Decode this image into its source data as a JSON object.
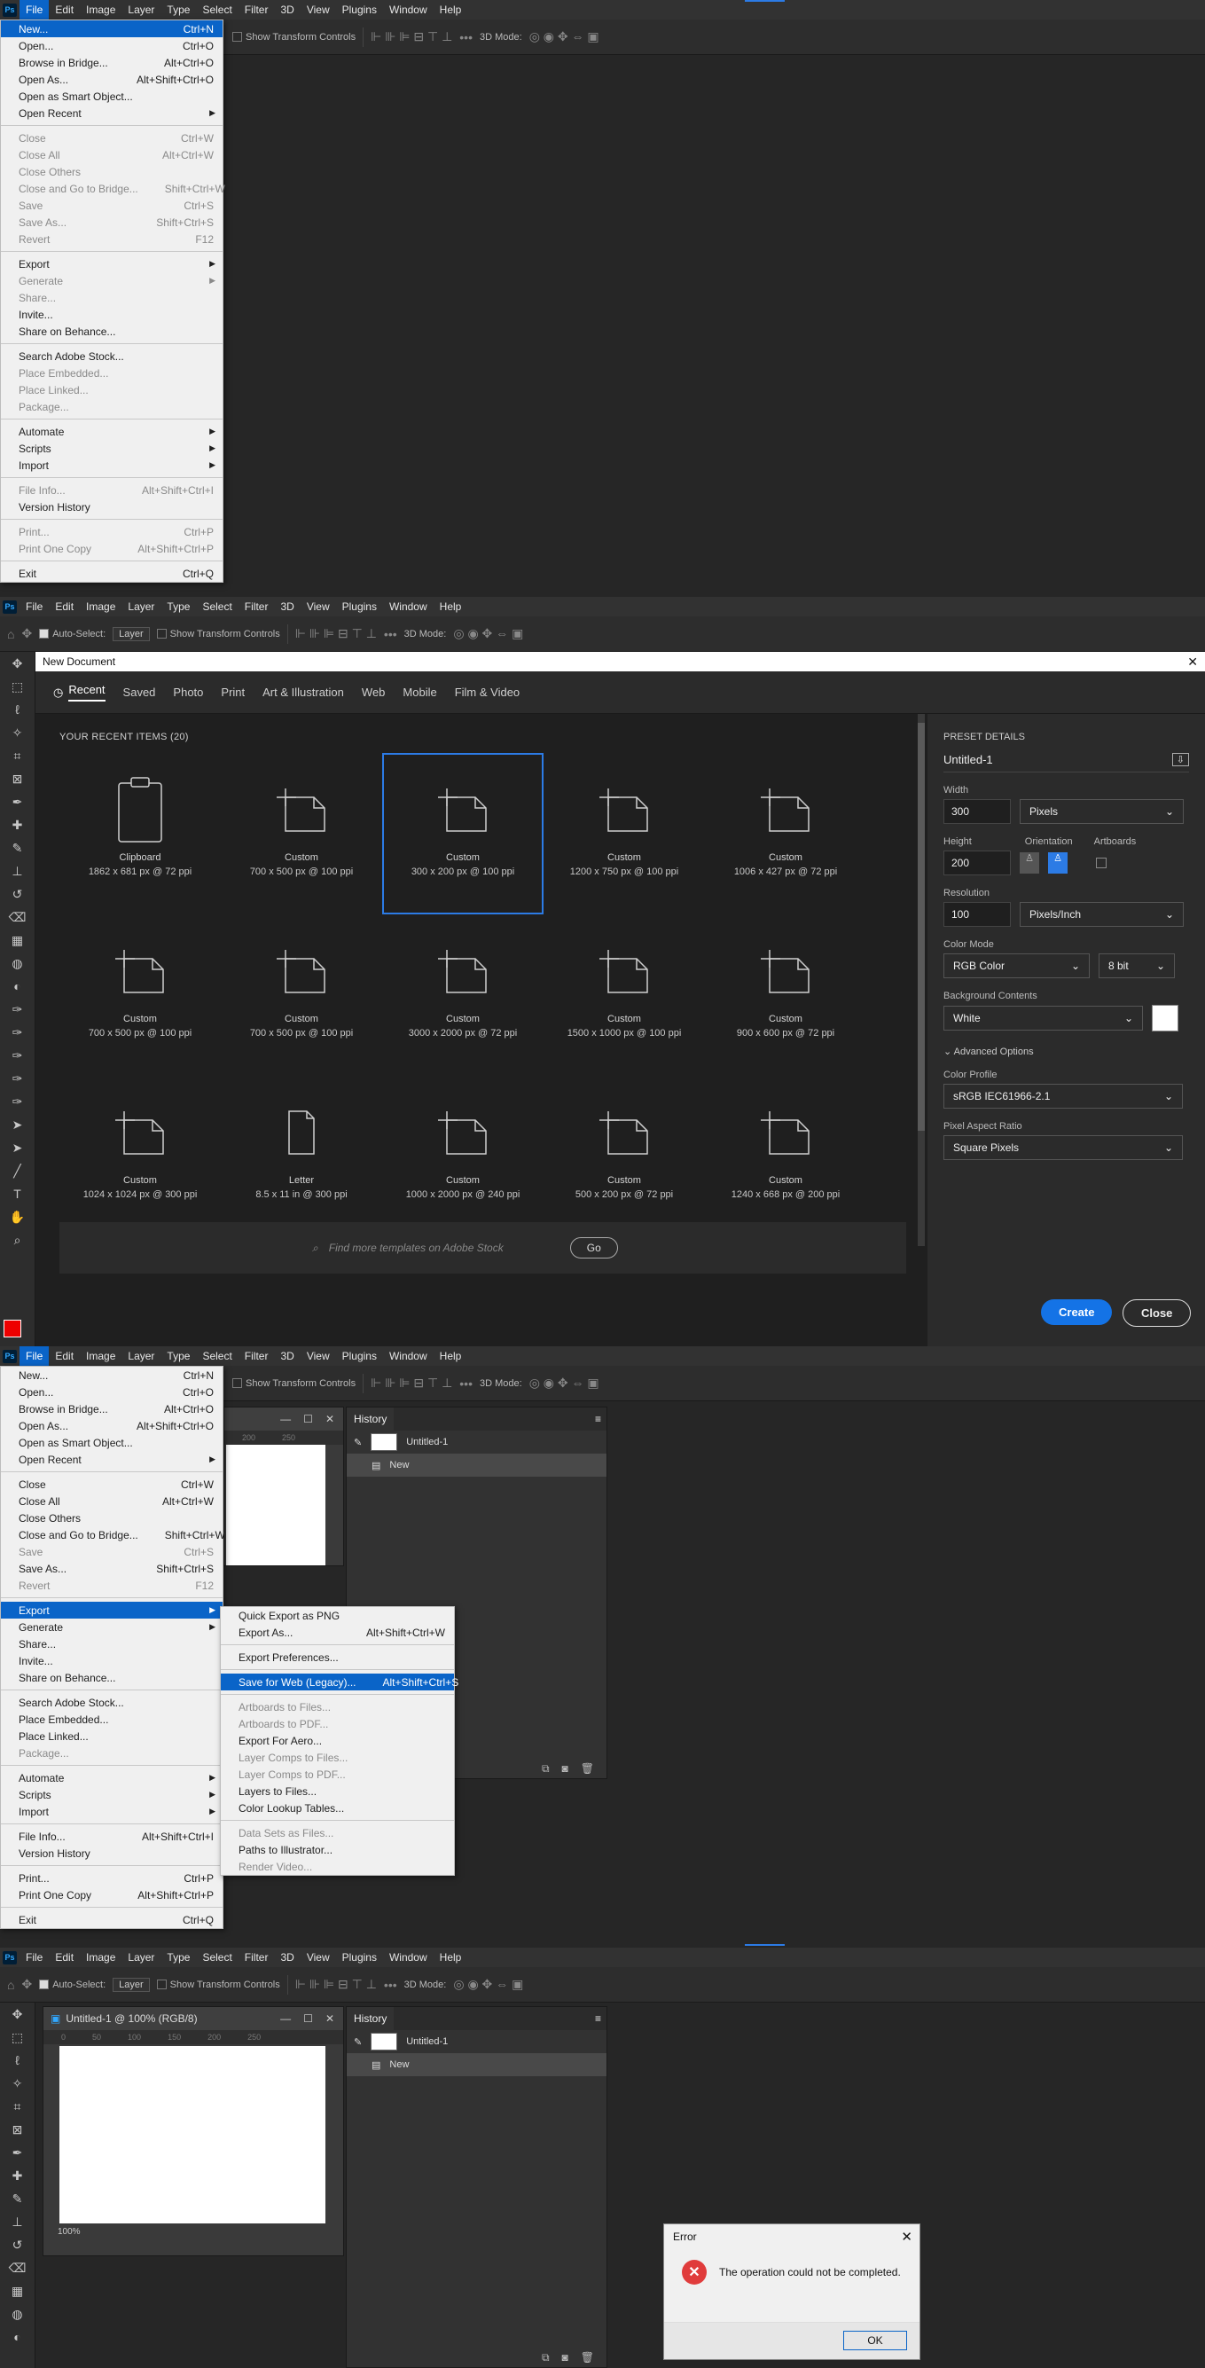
{
  "menubar": [
    "File",
    "Edit",
    "Image",
    "Layer",
    "Type",
    "Select",
    "Filter",
    "3D",
    "View",
    "Plugins",
    "Window",
    "Help"
  ],
  "ps_logo": "Ps",
  "options": {
    "show_transform": "Show Transform Controls",
    "auto_select": "Auto-Select:",
    "layer": "Layer",
    "mode_3d": "3D Mode:"
  },
  "file_menu_1": [
    {
      "l": "New...",
      "s": "Ctrl+N",
      "hl": true
    },
    {
      "l": "Open...",
      "s": "Ctrl+O"
    },
    {
      "l": "Browse in Bridge...",
      "s": "Alt+Ctrl+O"
    },
    {
      "l": "Open As...",
      "s": "Alt+Shift+Ctrl+O"
    },
    {
      "l": "Open as Smart Object..."
    },
    {
      "l": "Open Recent",
      "arrow": true
    },
    {
      "sep": true
    },
    {
      "l": "Close",
      "s": "Ctrl+W",
      "dis": true
    },
    {
      "l": "Close All",
      "s": "Alt+Ctrl+W",
      "dis": true
    },
    {
      "l": "Close Others",
      "dis": true
    },
    {
      "l": "Close and Go to Bridge...",
      "s": "Shift+Ctrl+W",
      "dis": true
    },
    {
      "l": "Save",
      "s": "Ctrl+S",
      "dis": true
    },
    {
      "l": "Save As...",
      "s": "Shift+Ctrl+S",
      "dis": true
    },
    {
      "l": "Revert",
      "s": "F12",
      "dis": true
    },
    {
      "sep": true
    },
    {
      "l": "Export",
      "arrow": true
    },
    {
      "l": "Generate",
      "arrow": true,
      "dis": true
    },
    {
      "l": "Share...",
      "dis": true
    },
    {
      "l": "Invite..."
    },
    {
      "l": "Share on Behance..."
    },
    {
      "sep": true
    },
    {
      "l": "Search Adobe Stock..."
    },
    {
      "l": "Place Embedded...",
      "dis": true
    },
    {
      "l": "Place Linked...",
      "dis": true
    },
    {
      "l": "Package...",
      "dis": true
    },
    {
      "sep": true
    },
    {
      "l": "Automate",
      "arrow": true
    },
    {
      "l": "Scripts",
      "arrow": true
    },
    {
      "l": "Import",
      "arrow": true
    },
    {
      "sep": true
    },
    {
      "l": "File Info...",
      "s": "Alt+Shift+Ctrl+I",
      "dis": true
    },
    {
      "l": "Version History"
    },
    {
      "sep": true
    },
    {
      "l": "Print...",
      "s": "Ctrl+P",
      "dis": true
    },
    {
      "l": "Print One Copy",
      "s": "Alt+Shift+Ctrl+P",
      "dis": true
    },
    {
      "sep": true
    },
    {
      "l": "Exit",
      "s": "Ctrl+Q"
    }
  ],
  "file_menu_3": [
    {
      "l": "New...",
      "s": "Ctrl+N"
    },
    {
      "l": "Open...",
      "s": "Ctrl+O"
    },
    {
      "l": "Browse in Bridge...",
      "s": "Alt+Ctrl+O"
    },
    {
      "l": "Open As...",
      "s": "Alt+Shift+Ctrl+O"
    },
    {
      "l": "Open as Smart Object..."
    },
    {
      "l": "Open Recent",
      "arrow": true
    },
    {
      "sep": true
    },
    {
      "l": "Close",
      "s": "Ctrl+W"
    },
    {
      "l": "Close All",
      "s": "Alt+Ctrl+W"
    },
    {
      "l": "Close Others"
    },
    {
      "l": "Close and Go to Bridge...",
      "s": "Shift+Ctrl+W"
    },
    {
      "l": "Save",
      "s": "Ctrl+S",
      "dis": true
    },
    {
      "l": "Save As...",
      "s": "Shift+Ctrl+S"
    },
    {
      "l": "Revert",
      "s": "F12",
      "dis": true
    },
    {
      "sep": true
    },
    {
      "l": "Export",
      "arrow": true,
      "hl": true
    },
    {
      "l": "Generate",
      "arrow": true
    },
    {
      "l": "Share..."
    },
    {
      "l": "Invite..."
    },
    {
      "l": "Share on Behance..."
    },
    {
      "sep": true
    },
    {
      "l": "Search Adobe Stock..."
    },
    {
      "l": "Place Embedded..."
    },
    {
      "l": "Place Linked..."
    },
    {
      "l": "Package...",
      "dis": true
    },
    {
      "sep": true
    },
    {
      "l": "Automate",
      "arrow": true
    },
    {
      "l": "Scripts",
      "arrow": true
    },
    {
      "l": "Import",
      "arrow": true
    },
    {
      "sep": true
    },
    {
      "l": "File Info...",
      "s": "Alt+Shift+Ctrl+I"
    },
    {
      "l": "Version History"
    },
    {
      "sep": true
    },
    {
      "l": "Print...",
      "s": "Ctrl+P"
    },
    {
      "l": "Print One Copy",
      "s": "Alt+Shift+Ctrl+P"
    },
    {
      "sep": true
    },
    {
      "l": "Exit",
      "s": "Ctrl+Q"
    }
  ],
  "export_menu": [
    {
      "l": "Quick Export as PNG"
    },
    {
      "l": "Export As...",
      "s": "Alt+Shift+Ctrl+W"
    },
    {
      "sep": true
    },
    {
      "l": "Export Preferences..."
    },
    {
      "sep": true
    },
    {
      "l": "Save for Web (Legacy)...",
      "s": "Alt+Shift+Ctrl+S",
      "hl": true
    },
    {
      "sep": true
    },
    {
      "l": "Artboards to Files...",
      "dis": true
    },
    {
      "l": "Artboards to PDF...",
      "dis": true
    },
    {
      "l": "Export For Aero..."
    },
    {
      "l": "Layer Comps to Files...",
      "dis": true
    },
    {
      "l": "Layer Comps to PDF...",
      "dis": true
    },
    {
      "l": "Layers to Files..."
    },
    {
      "l": "Color Lookup Tables..."
    },
    {
      "sep": true
    },
    {
      "l": "Data Sets as Files...",
      "dis": true
    },
    {
      "l": "Paths to Illustrator..."
    },
    {
      "l": "Render Video...",
      "dis": true
    }
  ],
  "new_doc": {
    "title": "New Document",
    "tabs": [
      "Recent",
      "Saved",
      "Photo",
      "Print",
      "Art & Illustration",
      "Web",
      "Mobile",
      "Film & Video"
    ],
    "section": "YOUR RECENT ITEMS  (20)",
    "items": [
      {
        "n": "Clipboard",
        "d": "1862 x 681 px @ 72 ppi",
        "icon": "clipboard"
      },
      {
        "n": "Custom",
        "d": "700 x 500 px @ 100 ppi",
        "icon": "doc"
      },
      {
        "n": "Custom",
        "d": "300 x 200 px @ 100 ppi",
        "icon": "doc",
        "sel": true
      },
      {
        "n": "Custom",
        "d": "1200 x 750 px @ 100 ppi",
        "icon": "doc"
      },
      {
        "n": "Custom",
        "d": "1006 x 427 px @ 72 ppi",
        "icon": "doc"
      },
      {
        "n": "Custom",
        "d": "700 x 500 px @ 100 ppi",
        "icon": "doc"
      },
      {
        "n": "Custom",
        "d": "700 x 500 px @ 100 ppi",
        "icon": "doc"
      },
      {
        "n": "Custom",
        "d": "3000 x 2000 px @ 72 ppi",
        "icon": "doc"
      },
      {
        "n": "Custom",
        "d": "1500 x 1000 px @ 100 ppi",
        "icon": "doc"
      },
      {
        "n": "Custom",
        "d": "900 x 600 px @ 72 ppi",
        "icon": "doc"
      },
      {
        "n": "Custom",
        "d": "1024 x 1024 px @ 300 ppi",
        "icon": "doc"
      },
      {
        "n": "Letter",
        "d": "8.5 x 11 in @ 300 ppi",
        "icon": "letter"
      },
      {
        "n": "Custom",
        "d": "1000 x 2000 px @ 240 ppi",
        "icon": "doc"
      },
      {
        "n": "Custom",
        "d": "500 x 200 px @ 72 ppi",
        "icon": "doc"
      },
      {
        "n": "Custom",
        "d": "1240 x 668 px @ 200 ppi",
        "icon": "doc"
      }
    ],
    "search_placeholder": "Find more templates on Adobe Stock",
    "go": "Go",
    "preset_details": "PRESET DETAILS",
    "doc_name": "Untitled-1",
    "width_label": "Width",
    "width": "300",
    "width_unit": "Pixels",
    "height_label": "Height",
    "height": "200",
    "orientation_label": "Orientation",
    "artboards_label": "Artboards",
    "resolution_label": "Resolution",
    "resolution": "100",
    "resolution_unit": "Pixels/Inch",
    "color_mode_label": "Color Mode",
    "color_mode": "RGB Color",
    "bit_depth": "8 bit",
    "bg_label": "Background Contents",
    "bg": "White",
    "advanced": "Advanced Options",
    "profile_label": "Color Profile",
    "profile": "sRGB IEC61966-2.1",
    "aspect_label": "Pixel Aspect Ratio",
    "aspect": "Square Pixels",
    "create": "Create",
    "close": "Close"
  },
  "doc_window": {
    "title": "Untitled-1 @ 100% (RGB/8)",
    "ruler": [
      "0",
      "50",
      "100",
      "150",
      "200",
      "250"
    ],
    "zoom": "100%"
  },
  "history": {
    "tab": "History",
    "snapshot": "Untitled-1",
    "state": "New"
  },
  "error": {
    "title": "Error",
    "message": "The operation could not be completed.",
    "ok": "OK"
  },
  "colors": {
    "accent": "#0a64c8",
    "selected_border": "#2c7be5",
    "create": "#1473e6"
  }
}
